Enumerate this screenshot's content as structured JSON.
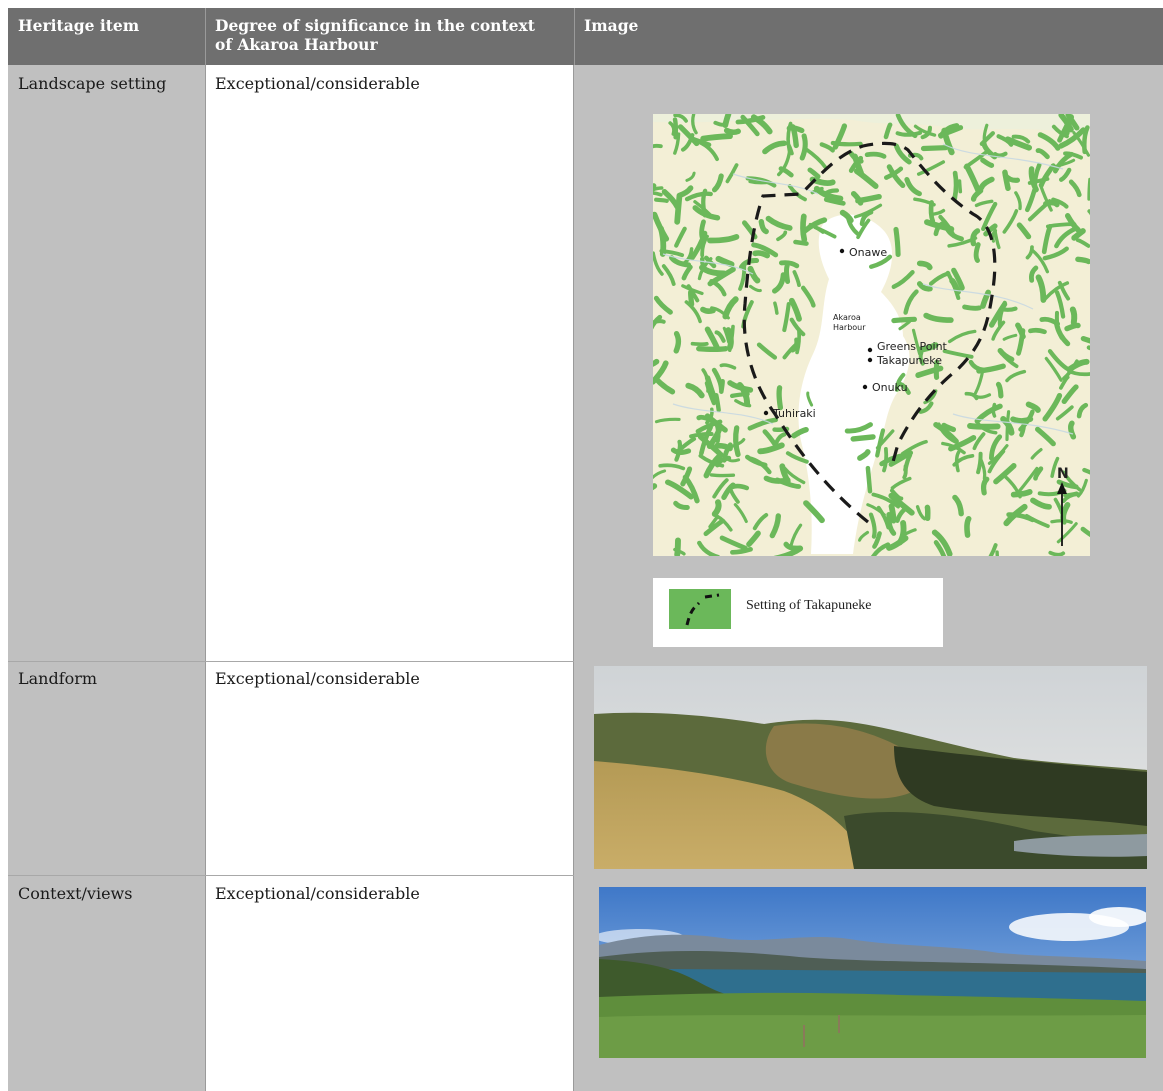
{
  "table": {
    "headers": {
      "item": "Heritage item",
      "significance_line1": "Degree of significance in the context",
      "significance_line2": "of Akaroa Harbour",
      "image": "Image"
    },
    "rows": [
      {
        "item": "Landscape setting",
        "significance": "Exceptional/considerable"
      },
      {
        "item": "Landform",
        "significance": "Exceptional/considerable"
      },
      {
        "item": "Context/views",
        "significance": "Exceptional/considerable"
      }
    ]
  },
  "map": {
    "places": {
      "onawe": "Onawe",
      "akaroa": "Akaroa",
      "harbour": "Harbour",
      "greens_point": "Greens Point",
      "takapuneke": "Takapuneke",
      "onuku": "Onuku",
      "tuhiraki": "Tuhiraki"
    },
    "north_label": "N",
    "legend_label": "Setting of Takapuneke"
  },
  "colors": {
    "header_bg": "#6f6f6f",
    "item_col_bg": "#c0c0c0",
    "land": "#f3efd6",
    "vegetation": "#6bb85a",
    "boundary": "#1a1a1a"
  }
}
